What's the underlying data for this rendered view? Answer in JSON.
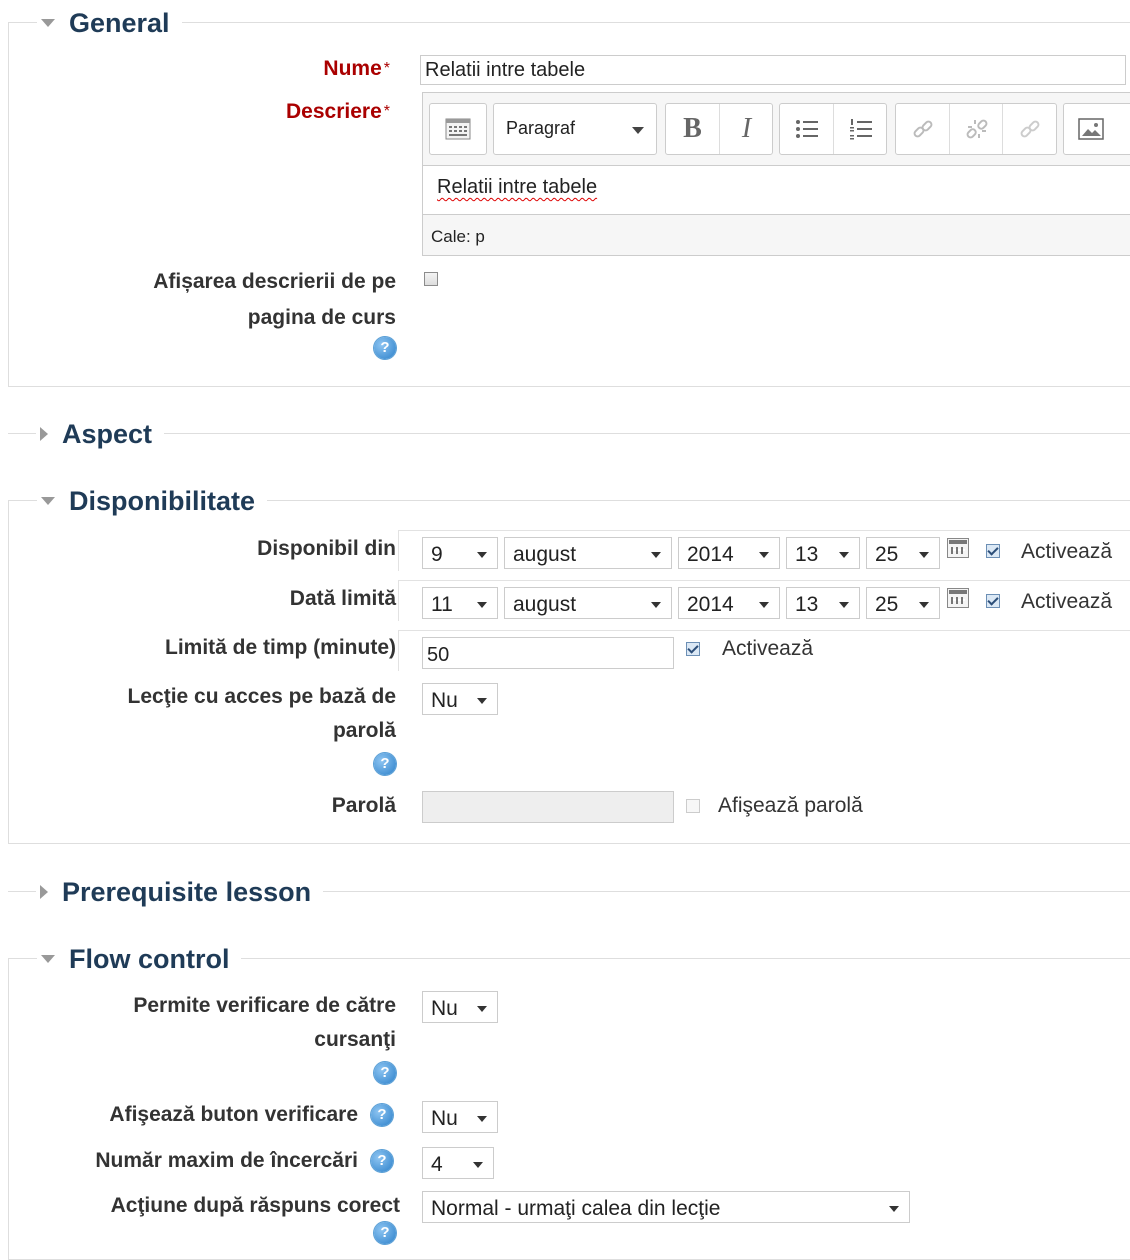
{
  "general": {
    "legend": "General",
    "name_label": "Nume",
    "name_value": "Relatii intre tabele",
    "desc_label": "Descriere",
    "editor": {
      "format_value": "Paragraf",
      "content": "Relatii intre tabele",
      "path": "Cale: p",
      "buttons": [
        "toolbar-toggle-icon",
        "bold-icon",
        "italic-icon",
        "bullet-list-icon",
        "numbered-list-icon",
        "link-icon",
        "unlink-icon",
        "anchor-icon",
        "image-icon"
      ]
    },
    "show_desc_label_line1": "Afișarea descrierii de pe",
    "show_desc_label_line2": "pagina de curs",
    "show_desc_checked": false
  },
  "aspect": {
    "legend": "Aspect"
  },
  "availability": {
    "legend": "Disponibilitate",
    "available_from": {
      "label": "Disponibil din",
      "day": "9",
      "month": "august",
      "year": "2014",
      "hour": "13",
      "minute": "25",
      "enable_label": "Activează",
      "enabled": true
    },
    "deadline": {
      "label": "Dată limită",
      "day": "11",
      "month": "august",
      "year": "2014",
      "hour": "13",
      "minute": "25",
      "enable_label": "Activează",
      "enabled": true
    },
    "time_limit": {
      "label": "Limită de timp (minute)",
      "value": "50",
      "enable_label": "Activează",
      "enabled": true
    },
    "password_lesson": {
      "label_line1": "Lecţie cu acces pe bază de",
      "label_line2": "parolă",
      "value": "Nu"
    },
    "password": {
      "label": "Parolă",
      "value": "",
      "reveal_label": "Afişează parolă",
      "reveal_checked": false
    }
  },
  "prerequisite": {
    "legend": "Prerequisite lesson"
  },
  "flow": {
    "legend": "Flow control",
    "allow_review": {
      "label_line1": "Permite verificare de către",
      "label_line2": "cursanţi",
      "value": "Nu"
    },
    "review_button": {
      "label": "Afişează buton verificare",
      "value": "Nu"
    },
    "max_attempts": {
      "label": "Număr maxim de încercări",
      "value": "4"
    },
    "correct_action": {
      "label": "Acţiune după răspuns corect",
      "value": "Normal - urmaţi calea din lecţie"
    }
  },
  "colors": {
    "legend": "#1f3b57",
    "required": "#aa0000",
    "help": "#2a7fc9"
  }
}
